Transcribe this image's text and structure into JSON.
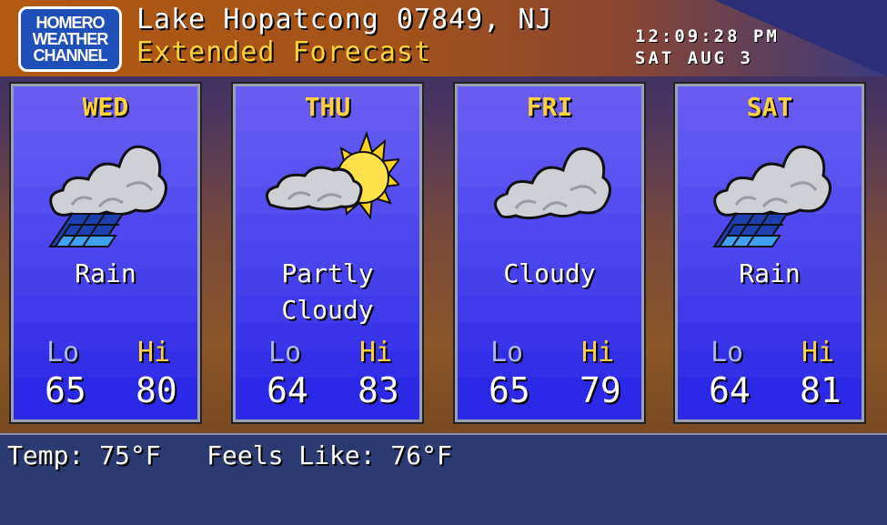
{
  "header": {
    "logo_lines": [
      "HOMERO",
      "WEATHER",
      "CHANNEL"
    ],
    "location": "Lake Hopatcong 07849, NJ",
    "subtitle": "Extended Forecast",
    "time": "12:09:28 PM",
    "date": "SAT AUG 3"
  },
  "forecast": [
    {
      "day": "WED",
      "icon": "rain-icon",
      "condition": "Rain",
      "lo_label": "Lo",
      "hi_label": "Hi",
      "lo": "65",
      "hi": "80"
    },
    {
      "day": "THU",
      "icon": "partly-cloudy-icon",
      "condition": "Partly\nCloudy",
      "lo_label": "Lo",
      "hi_label": "Hi",
      "lo": "64",
      "hi": "83"
    },
    {
      "day": "FRI",
      "icon": "cloudy-icon",
      "condition": "Cloudy",
      "lo_label": "Lo",
      "hi_label": "Hi",
      "lo": "65",
      "hi": "79"
    },
    {
      "day": "SAT",
      "icon": "rain-icon",
      "condition": "Rain",
      "lo_label": "Lo",
      "hi_label": "Hi",
      "lo": "64",
      "hi": "81"
    }
  ],
  "footer": {
    "current": "Temp: 75°F   Feels Like: 76°F"
  },
  "colors": {
    "accent_yellow": "#ffd23c",
    "card_blue": "#4a44ee",
    "footer_blue": "#2c3a72"
  }
}
